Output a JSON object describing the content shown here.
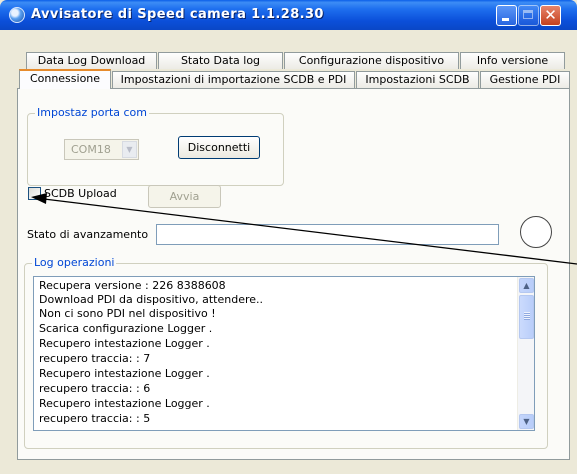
{
  "window": {
    "title": "Avvisatore di Speed camera  1.1.28.30",
    "icon": "app-globe-icon",
    "colors": {
      "titlebar": "#0b4fd9",
      "close_button": "#c3411e",
      "group_title": "#0046d5",
      "active_tab_accent": "#e68b2c"
    }
  },
  "tabs": {
    "row1": [
      "Data Log Download",
      "Stato Data log",
      "Configurazione dispositivo",
      "Info versione"
    ],
    "row2": [
      "Connessione",
      "Impostazioni di importazione SCDB e PDI",
      "Impostazioni SCDB",
      "Gestione PDI"
    ],
    "active": "Connessione"
  },
  "com_port": {
    "group_title": "Impostaz  porta com",
    "selected": "COM18",
    "disconnect_label": "Disconnetti"
  },
  "scdb_upload": {
    "checkbox_label": "SCDB Upload",
    "checked": false,
    "start_label": "Avvia"
  },
  "progress": {
    "label": "Stato di avanzamento"
  },
  "log": {
    "group_title": "Log operazioni",
    "lines": [
      "Recupera versione :  226    8388608",
      "Download PDI da dispositivo, attendere..",
      "Non ci sono PDI nel dispositivo !",
      "Scarica configurazione Logger .",
      "Recupero intestazione Logger .",
      "recupero traccia: : 7",
      "Recupero intestazione Logger .",
      "recupero traccia: : 6",
      "Recupero intestazione Logger .",
      "recupero traccia: : 5"
    ]
  }
}
